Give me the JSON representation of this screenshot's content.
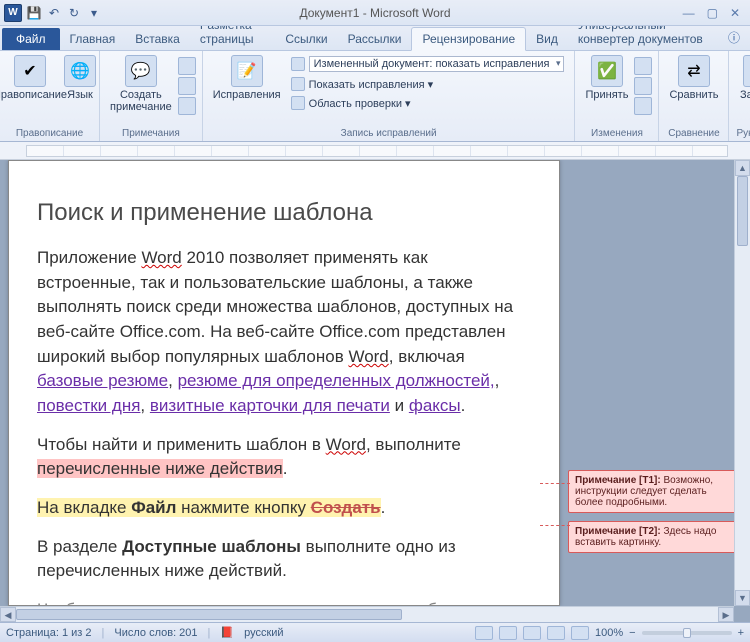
{
  "title": "Документ1 - Microsoft Word",
  "app_letter": "W",
  "tabs": {
    "file": "Файл",
    "list": [
      "Главная",
      "Вставка",
      "Разметка страницы",
      "Ссылки",
      "Рассылки",
      "Рецензирование",
      "Вид",
      "Универсальный конвертер документов"
    ],
    "active_index": 5
  },
  "ribbon": {
    "proofing": {
      "label": "Правописание",
      "big": "Правописание",
      "lang": "Язык"
    },
    "comments": {
      "label": "Примечания",
      "big": "Создать\nпримечание"
    },
    "tracking": {
      "label": "Запись исправлений",
      "big": "Исправления",
      "combo1": "Измененный документ: показать исправления",
      "row2": "Показать исправления ▾",
      "row3": "Область проверки ▾"
    },
    "changes": {
      "label": "Изменения",
      "big": "Принять"
    },
    "compare": {
      "label": "Сравнение",
      "big": "Сравнить"
    },
    "protect": {
      "label": "Рукопис...",
      "big": "Защита"
    }
  },
  "doc": {
    "h1": "Поиск и применение шаблона",
    "p1a": "Приложение ",
    "p1_word": "Word",
    "p1b": " 2010 позволяет применять как встроенные, так и пользовательские шаблоны, а также выполнять поиск среди множества шаблонов, доступных на веб-сайте Office.com. На веб-сайте Office.com представлен широкий выбор популярных шаблонов ",
    "p1_word2": "Word",
    "p1c": ", включая ",
    "link1": "базовые резюме",
    "p1d": ", ",
    "link2": "резюме для определенных должностей,",
    "p1e": ", ",
    "link3": "повестки дня",
    "p1f": ", ",
    "link4": "визитные карточки для печати",
    "p1g": " и ",
    "link5": "факсы",
    "p1h": ".",
    "p2a": "Чтобы найти и применить шаблон в ",
    "p2_word": "Word",
    "p2b": ", выполните ",
    "p2_hl": "перечисленные ниже действия",
    "p2c": ".",
    "p3a_hl": "На вкладке ",
    "p3_file": "Файл",
    "p3b_hl": " нажмите кнопку ",
    "p3_create": "Создать",
    "p3c": ".",
    "p4a": "В разделе ",
    "p4_bold": "Доступные шаблоны",
    "p4b": " выполните одно из перечисленных ниже действий.",
    "p5": "Чтобы воспользоваться одним из встроенных шаблонов"
  },
  "comments": [
    {
      "tag": "Примечание [T1]:",
      "text": " Возможно, инструкции следует сделать более подробными."
    },
    {
      "tag": "Примечание [T2]:",
      "text": " Здесь надо вставить картинку."
    }
  ],
  "status": {
    "page": "Страница: 1 из 2",
    "words": "Число слов: 201",
    "lang": "русский",
    "zoom": "100%"
  }
}
